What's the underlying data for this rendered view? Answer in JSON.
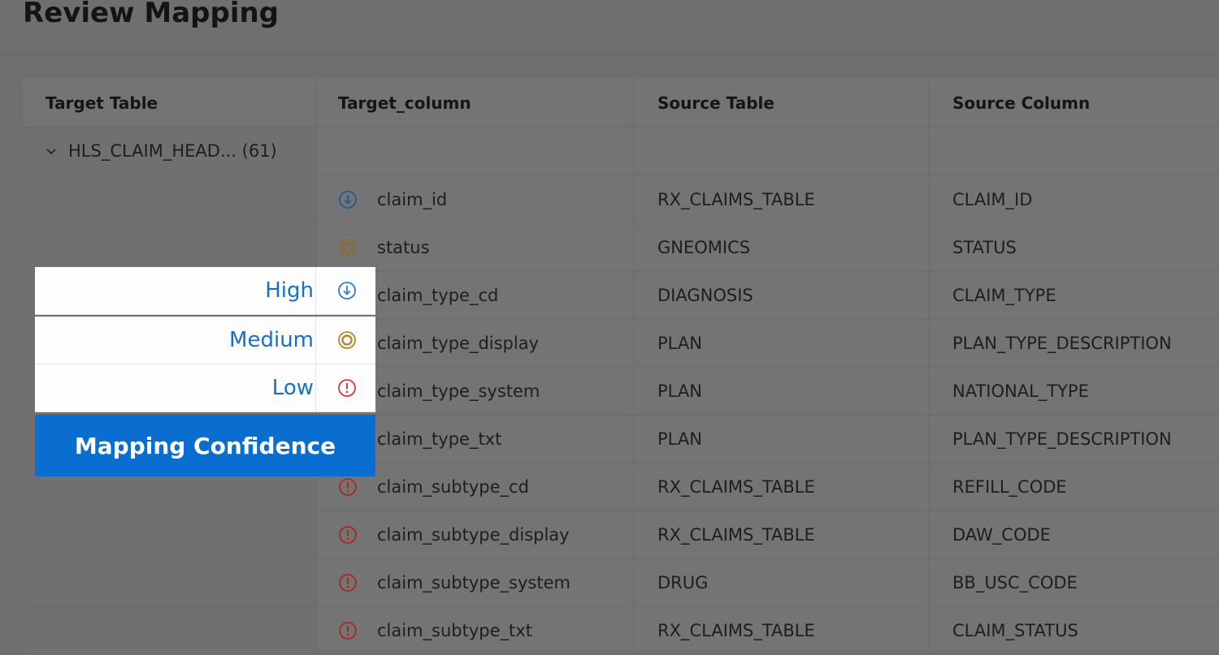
{
  "page": {
    "title": "Review Mapping"
  },
  "colors": {
    "high": "#1f5c8f",
    "medium": "#8a6d2e",
    "low": "#a82828",
    "legend_high": "#2f7fc8",
    "legend_medium": "#b08a2a",
    "legend_low": "#d63a3a",
    "accent": "#0a6ed1"
  },
  "table": {
    "headers": {
      "target_table": "Target Table",
      "target_column": "Target_column",
      "source_table": "Source Table",
      "source_column": "Source Column"
    },
    "group": {
      "label": "HLS_CLAIM_HEAD... (61)",
      "chevron_icon": "chevron-down-icon"
    },
    "rows": [
      {
        "confidence": "high",
        "target_column": "claim_id",
        "source_table": "RX_CLAIMS_TABLE",
        "source_column": "CLAIM_ID"
      },
      {
        "confidence": "medium",
        "target_column": "status",
        "source_table": "GNEOMICS",
        "source_column": "STATUS"
      },
      {
        "confidence": "high",
        "target_column": "claim_type_cd",
        "source_table": "DIAGNOSIS",
        "source_column": "CLAIM_TYPE"
      },
      {
        "confidence": "medium",
        "target_column": "claim_type_display",
        "source_table": "PLAN",
        "source_column": "PLAN_TYPE_DESCRIPTION"
      },
      {
        "confidence": "low",
        "target_column": "claim_type_system",
        "source_table": "PLAN",
        "source_column": "NATIONAL_TYPE"
      },
      {
        "confidence": "medium",
        "target_column": "claim_type_txt",
        "source_table": "PLAN",
        "source_column": "PLAN_TYPE_DESCRIPTION"
      },
      {
        "confidence": "low",
        "target_column": "claim_subtype_cd",
        "source_table": "RX_CLAIMS_TABLE",
        "source_column": "REFILL_CODE"
      },
      {
        "confidence": "low",
        "target_column": "claim_subtype_display",
        "source_table": "RX_CLAIMS_TABLE",
        "source_column": "DAW_CODE"
      },
      {
        "confidence": "low",
        "target_column": "claim_subtype_system",
        "source_table": "DRUG",
        "source_column": "BB_USC_CODE"
      },
      {
        "confidence": "low",
        "target_column": "claim_subtype_txt",
        "source_table": "RX_CLAIMS_TABLE",
        "source_column": "CLAIM_STATUS"
      }
    ]
  },
  "legend": {
    "items": [
      {
        "label": "High",
        "level": "high",
        "icon": "arrow-down-circle-icon"
      },
      {
        "label": "Medium",
        "level": "medium",
        "icon": "target-icon"
      },
      {
        "label": "Low",
        "level": "low",
        "icon": "alert-circle-icon"
      }
    ],
    "title": "Mapping Confidence"
  }
}
